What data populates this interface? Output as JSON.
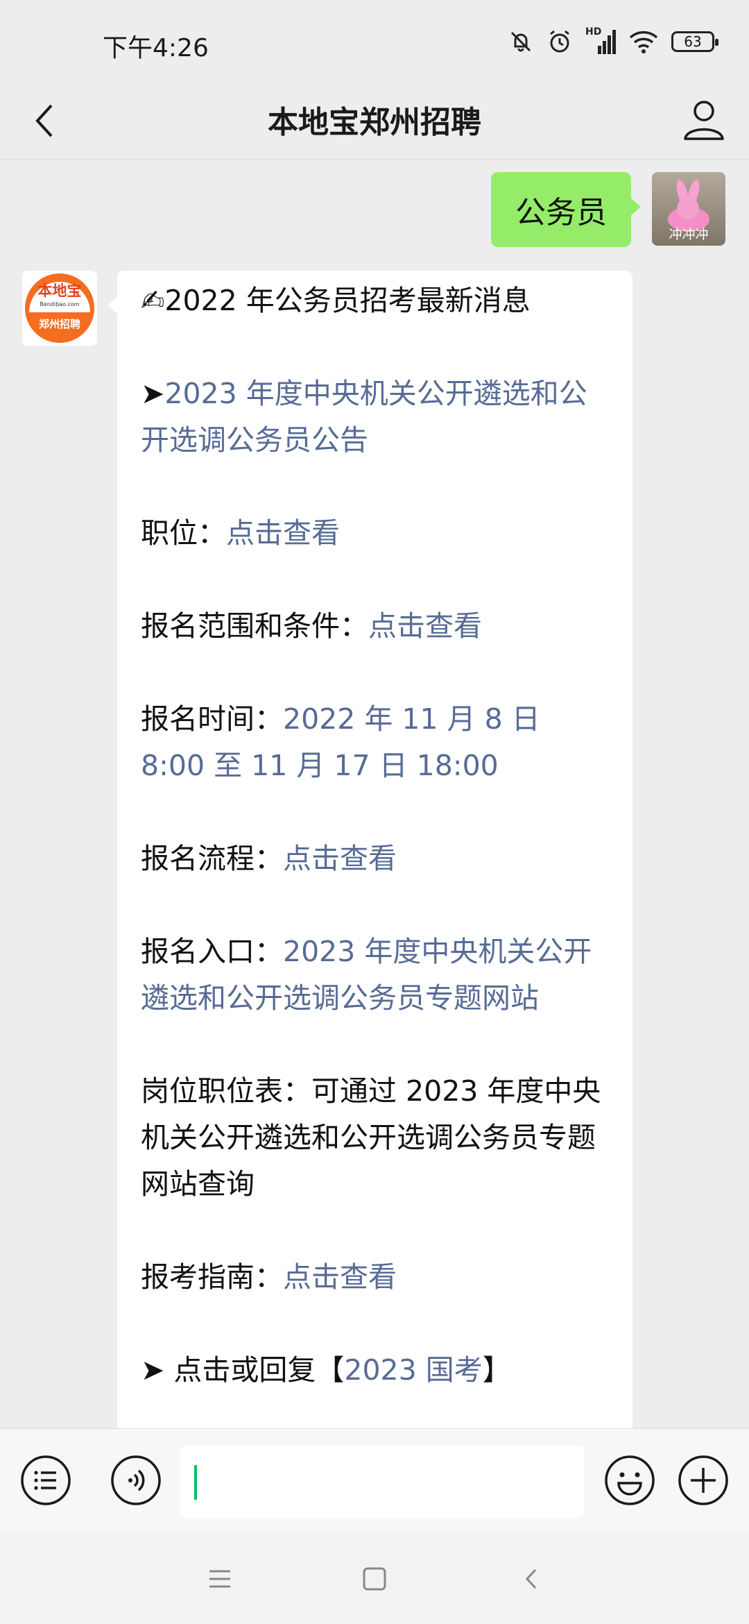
{
  "status_bar": {
    "time": "下午4:26",
    "network_label": "HD",
    "battery": "63",
    "icons": [
      "mute-bell-icon",
      "alarm-icon",
      "signal-icon",
      "wifi-icon",
      "battery-icon"
    ]
  },
  "nav": {
    "title": "本地宝郑州招聘",
    "icons": [
      "back-arrow-icon",
      "profile-icon"
    ]
  },
  "chat": {
    "sent_message": "公务员",
    "user_avatar_label": "冲冲冲",
    "bot_avatar": {
      "brand": "本地宝",
      "domain": "Bendibao.com",
      "sub": "郑州招聘",
      "color": "#f46d20"
    },
    "message": {
      "headline": "✍2022 年公务员招考最新消息",
      "notice_prefix": "➤",
      "notice_link": "2023 年度中央机关公开遴选和公开选调公务员公告",
      "position_label": "职位：",
      "position_link": "点击查看",
      "scope_label": "报名范围和条件：",
      "scope_link": "点击查看",
      "time_label": "报名时间：",
      "time_value": "2022 年 11 月 8 日 8:00 至 11 月 17 日 18:00",
      "process_label": "报名流程：",
      "process_link": "点击查看",
      "entry_label": "报名入口：",
      "entry_link": "2023 年度中央机关公开遴选和公开选调公务员专题网站",
      "table_text": "岗位职位表：可通过 2023 年度中央机关公开遴选和公开选调公务员专题网站查询",
      "guide_label": "报考指南：",
      "guide_link": "点击查看",
      "reply_prefix": "➤ 点击或回复【",
      "reply_link": "2023 国考",
      "reply_suffix": "】"
    }
  },
  "input_bar": {
    "icons": [
      "menu-list-icon",
      "voice-icon",
      "emoji-icon",
      "add-icon"
    ],
    "value": ""
  },
  "colors": {
    "sent_bubble": "#95ec69",
    "link": "#576b95",
    "background": "#ededed",
    "caret": "#07c160"
  }
}
